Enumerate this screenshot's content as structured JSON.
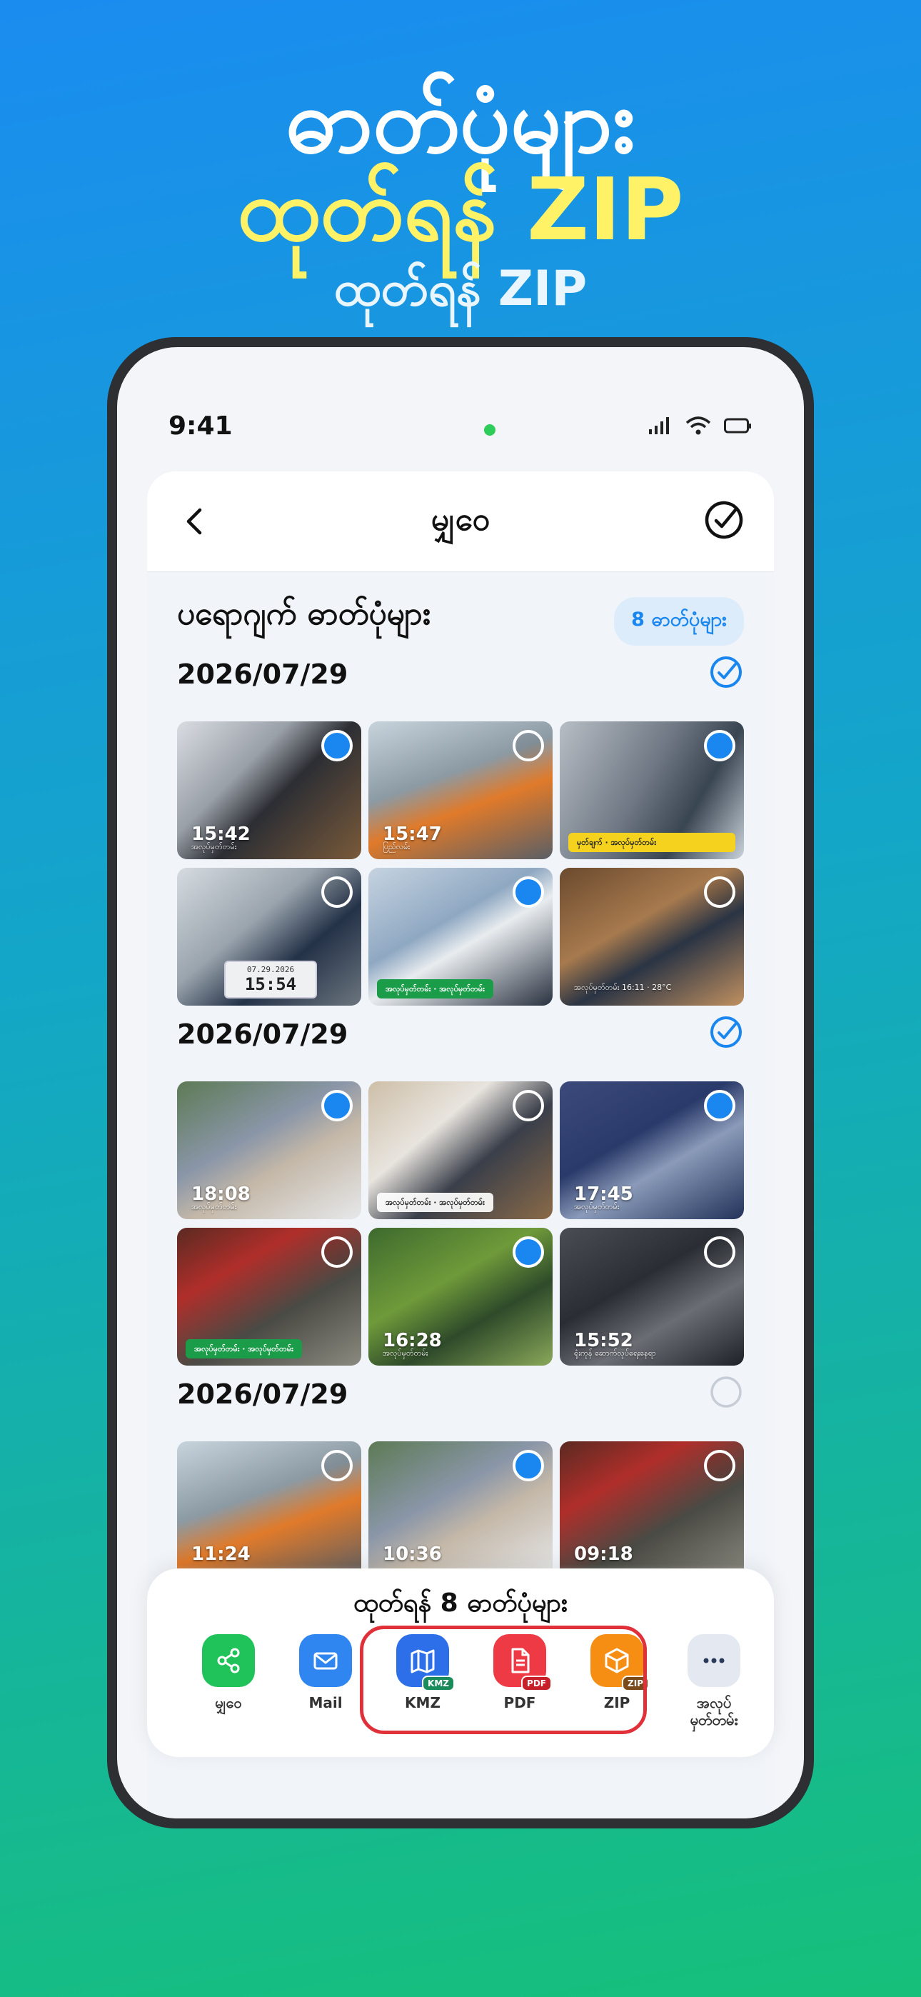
{
  "headline": {
    "line1": "ဓာတ်ပုံများ",
    "line2": "ထုတ်ရန် ZIP",
    "line3": "ထုတ်ရန် ZIP"
  },
  "status_bar": {
    "time": "9:41"
  },
  "nav": {
    "title": "မျှဝေ"
  },
  "section": {
    "title": "ပရောဂျက် ဓာတ်ပုံများ",
    "count_pill": "8 ဓာတ်ပုံများ"
  },
  "groups": [
    {
      "date": "2026/07/29",
      "all_selected": true,
      "photos": [
        {
          "selected": true,
          "time": "15:42",
          "sub": "အလုပ်မှတ်တမ်း"
        },
        {
          "selected": false,
          "time": "15:47",
          "sub": "ပြည်လမ်း"
        },
        {
          "selected": true,
          "stamp": "မှတ်ချက် · အလုပ်မှတ်တမ်း"
        },
        {
          "selected": false,
          "clock_date": "07.29.2026",
          "clock_time": "15:54"
        },
        {
          "selected": true,
          "stamp": "အလုပ်မှတ်တမ်း · အလုပ်မှတ်တမ်း"
        },
        {
          "selected": false,
          "sub": "အလုပ်မှတ်တမ်း 16:11 · 28°C"
        }
      ]
    },
    {
      "date": "2026/07/29",
      "all_selected": true,
      "photos": [
        {
          "selected": true,
          "time": "18:08",
          "sub": "အလုပ်မှတ်တမ်း"
        },
        {
          "selected": false,
          "stamp": "အလုပ်မှတ်တမ်း · အလုပ်မှတ်တမ်း"
        },
        {
          "selected": true,
          "time": "17:45",
          "sub": "အလုပ်မှတ်တမ်း"
        },
        {
          "selected": false,
          "stamp": "အလုပ်မှတ်တမ်း · အလုပ်မှတ်တမ်း"
        },
        {
          "selected": true,
          "time": "16:28",
          "sub": "အလုပ်မှတ်တမ်း"
        },
        {
          "selected": false,
          "time": "15:52",
          "sub": "ရုံးကုန် ဆောက်လုပ်ရေးနေရာ"
        }
      ]
    },
    {
      "date": "2026/07/29",
      "all_selected": false,
      "photos": [
        {
          "selected": false,
          "time": "11:24"
        },
        {
          "selected": true,
          "time": "10:36"
        },
        {
          "selected": false,
          "time": "09:18"
        }
      ]
    }
  ],
  "share_sheet": {
    "title": "ထုတ်ရန် 8 ဓာတ်ပုံများ",
    "actions": [
      {
        "label": "မျှဝေ",
        "icon": "share-icon",
        "color": "#1fc35a"
      },
      {
        "label": "Mail",
        "icon": "mail-icon",
        "color": "#2f86f0"
      },
      {
        "label": "KMZ",
        "icon": "map-icon",
        "color": "#2d6fe8",
        "badge": "KMZ",
        "badge_color": "#1a8c5b"
      },
      {
        "label": "PDF",
        "icon": "pdf-icon",
        "color": "#ee3a45",
        "badge": "PDF",
        "badge_color": "#c8202a"
      },
      {
        "label": "ZIP",
        "icon": "box-icon",
        "color": "#f58e12",
        "badge": "ZIP",
        "badge_color": "#7a4a1a"
      },
      {
        "label_line1": "အလုပ်",
        "label_line2": "မှတ်တမ်း",
        "icon": "more-icon",
        "color": "#e4e9f1"
      }
    ]
  },
  "colors": {
    "accent": "#1a86f0",
    "highlight": "#e0313b",
    "headline_yellow": "#fff267"
  }
}
